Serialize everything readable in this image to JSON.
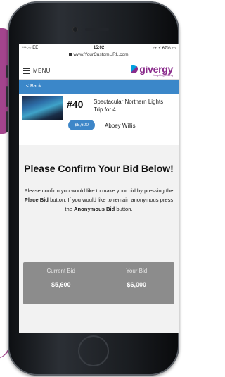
{
  "status_bar": {
    "carrier": "•••○○ EE",
    "time": "15:02",
    "battery": "67%"
  },
  "browser": {
    "url": "www.YourCustomURL.com"
  },
  "nav": {
    "menu_label": "MENU"
  },
  "brand": {
    "name": "givergy",
    "tagline": "Inspiring Giving",
    "color": "#8a2b8b",
    "accent": "#00a0df"
  },
  "back_bar": {
    "label": "< Back",
    "color": "#3b87c9"
  },
  "item": {
    "lot_number": "#40",
    "title": "Spectacular Northern Lights Trip for 4",
    "current_bid": "$5,600",
    "bidder": "Abbey Willis"
  },
  "confirm": {
    "heading": "Please Confirm Your Bid Below!",
    "text_part1": "Please confirm you would like to make your bid by pressing the",
    "place_bid": "Place Bid",
    "text_part2": "button. If you would like to remain anonymous press the",
    "anonymous_bid": "Anonymous Bid",
    "text_part3": "button."
  },
  "bid_summary": {
    "current_label": "Current Bid",
    "current_value": "$5,600",
    "your_label": "Your Bid",
    "your_value": "$6,000"
  }
}
